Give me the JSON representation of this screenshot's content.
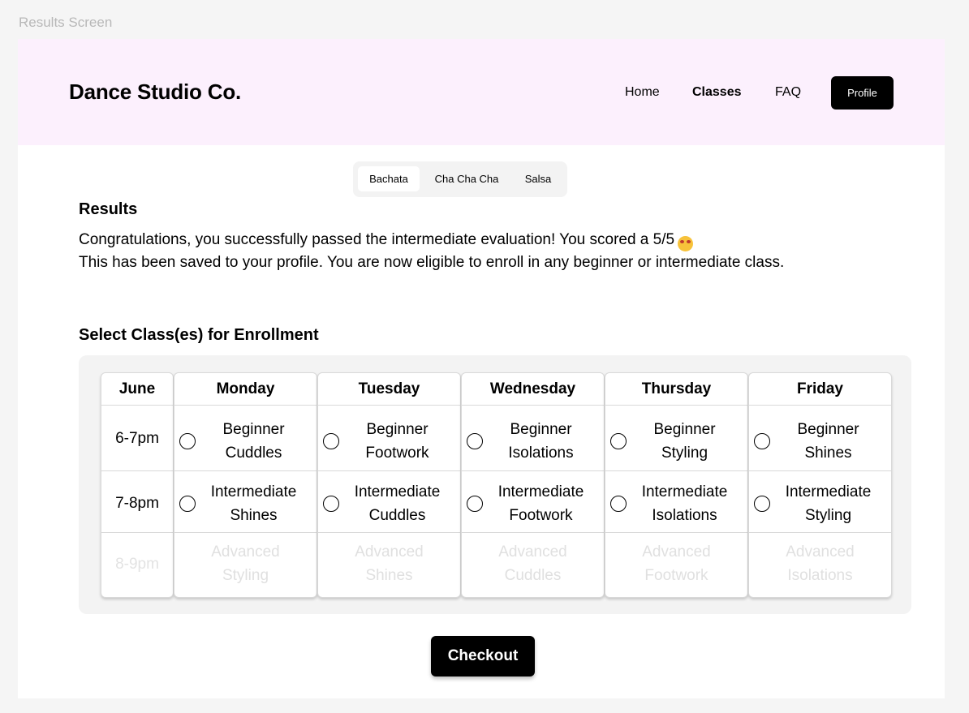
{
  "frame_label": "Results Screen",
  "header": {
    "brand": "Dance Studio Co.",
    "nav": [
      "Home",
      "Classes",
      "FAQ"
    ],
    "profile_label": "Profile"
  },
  "tabs": [
    "Bachata",
    "Cha Cha Cha",
    "Salsa"
  ],
  "results": {
    "title": "Results",
    "line1": "Congratulations, you successfully passed the intermediate evaluation! You scored a 5/5",
    "emoji": "🤩",
    "line2": "This has been saved to your profile. You are now eligible to enroll in any beginner or intermediate class."
  },
  "enroll": {
    "title": "Select Class(es) for Enrollment",
    "month": "June",
    "times": [
      "6-7pm",
      "7-8pm",
      "8-9pm"
    ],
    "days": [
      {
        "name": "Monday",
        "classes": [
          [
            "Beginner",
            "Cuddles"
          ],
          [
            "Intermediate",
            "Shines"
          ],
          [
            "Advanced",
            "Styling"
          ]
        ]
      },
      {
        "name": "Tuesday",
        "classes": [
          [
            "Beginner",
            "Footwork"
          ],
          [
            "Intermediate",
            "Cuddles"
          ],
          [
            "Advanced",
            "Shines"
          ]
        ]
      },
      {
        "name": "Wednesday",
        "classes": [
          [
            "Beginner",
            "Isolations"
          ],
          [
            "Intermediate",
            "Footwork"
          ],
          [
            "Advanced",
            "Cuddles"
          ]
        ]
      },
      {
        "name": "Thursday",
        "classes": [
          [
            "Beginner",
            "Styling"
          ],
          [
            "Intermediate",
            "Isolations"
          ],
          [
            "Advanced",
            "Footwork"
          ]
        ]
      },
      {
        "name": "Friday",
        "classes": [
          [
            "Beginner",
            "Shines"
          ],
          [
            "Intermediate",
            "Styling"
          ],
          [
            "Advanced",
            "Isolations"
          ]
        ]
      }
    ]
  },
  "checkout_label": "Checkout"
}
